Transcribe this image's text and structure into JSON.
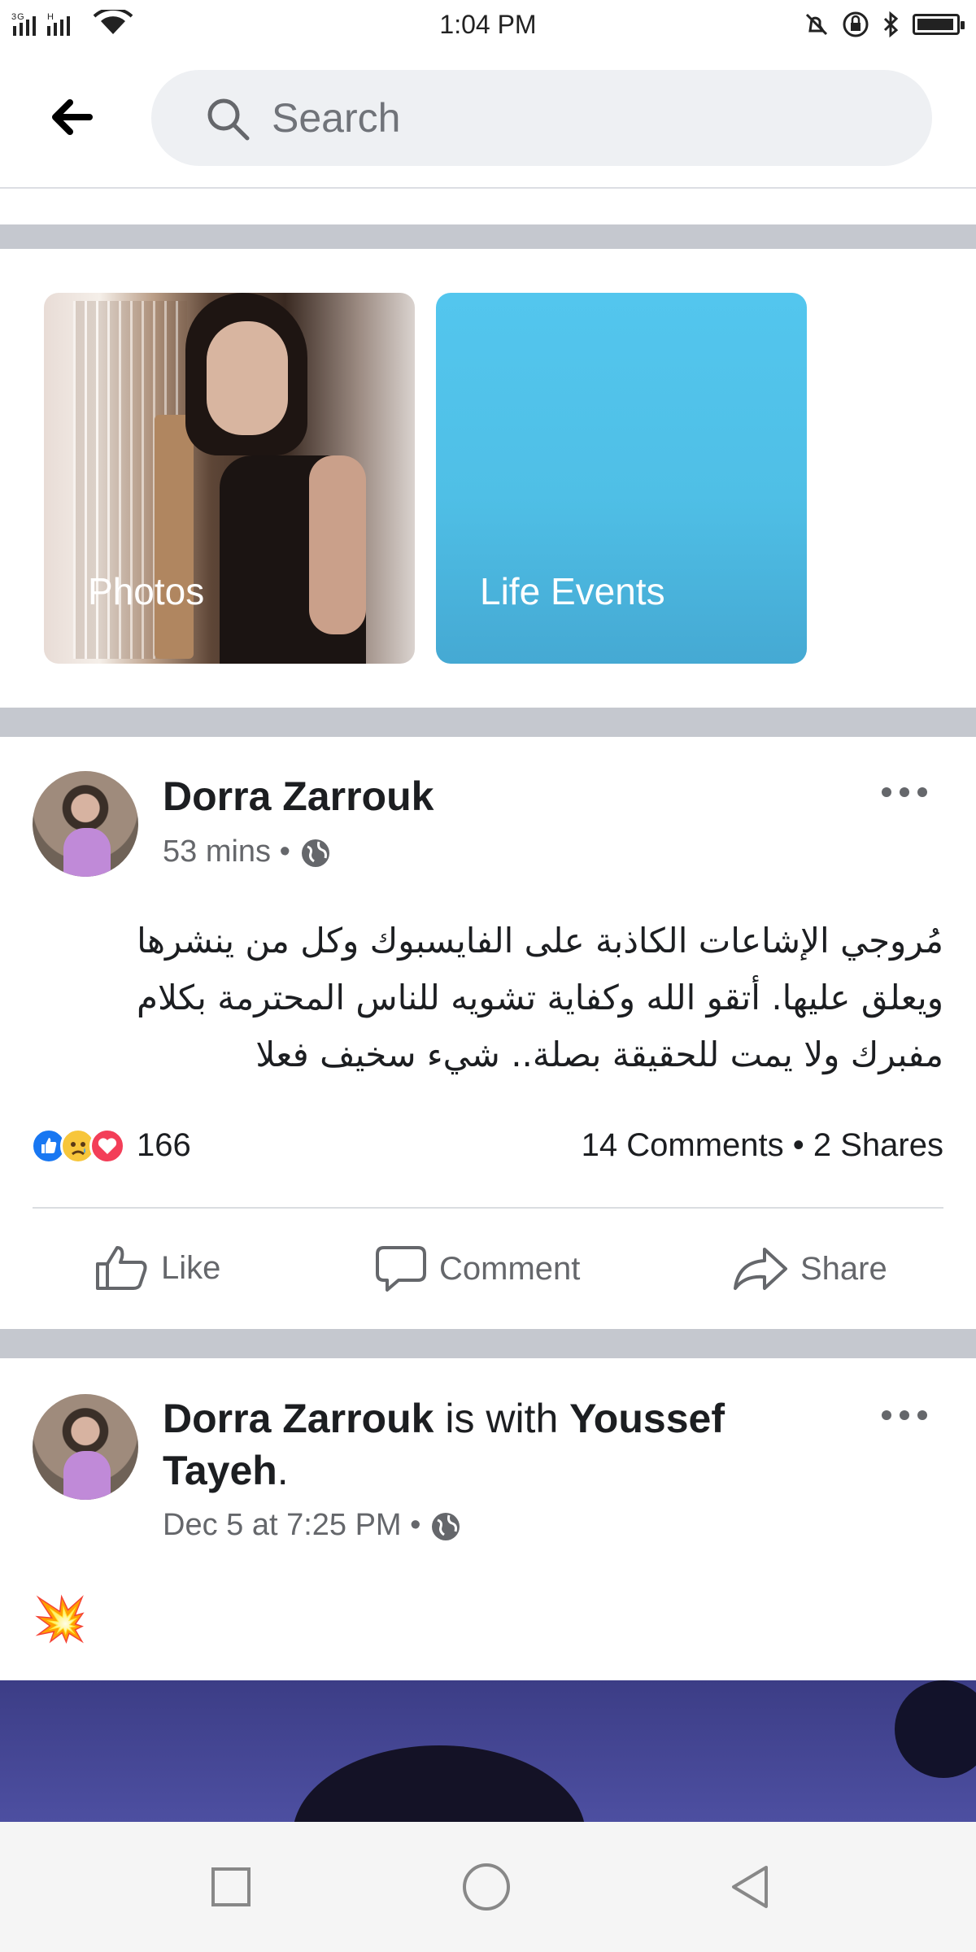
{
  "status_bar": {
    "network": "3G H",
    "time": "1:04 PM",
    "icons": [
      "mute-icon",
      "lock-rotation-icon",
      "bluetooth-icon",
      "battery-icon"
    ]
  },
  "header": {
    "search_placeholder": "Search"
  },
  "tiles": [
    {
      "label": "Photos"
    },
    {
      "label": "Life Events",
      "color": "#53c6ee"
    }
  ],
  "posts": [
    {
      "author": "Dorra Zarrouk",
      "time": "53 mins",
      "privacy": "globe-icon",
      "text_lines": [
        "مُروجي الإشاعات الكاذبة على الفايسبوك وكل من ينشرها",
        "ويعلق عليها. أتقو الله  وكفاية تشويه للناس المحترمة بكلام",
        "مفبرك ولا يمت للحقيقة بصلة..  شيء سخيف فعلا"
      ],
      "reaction_count": "166",
      "comments": "14 Comments",
      "shares": "2 Shares",
      "actions": {
        "like": "Like",
        "comment": "Comment",
        "share": "Share"
      }
    },
    {
      "author": "Dorra Zarrouk",
      "with_text": "is with",
      "tagged": "Youssef",
      "tagged_line2": "Tayeh",
      "time": "Dec 5 at 7:25 PM",
      "privacy": "globe-icon",
      "emoji": "💥"
    }
  ],
  "colors": {
    "separator": "#c5c8cf",
    "search_bg": "#eef0f3",
    "like_blue": "#1877f2",
    "love_red": "#f33e58",
    "sad_yellow": "#f7c63b"
  }
}
